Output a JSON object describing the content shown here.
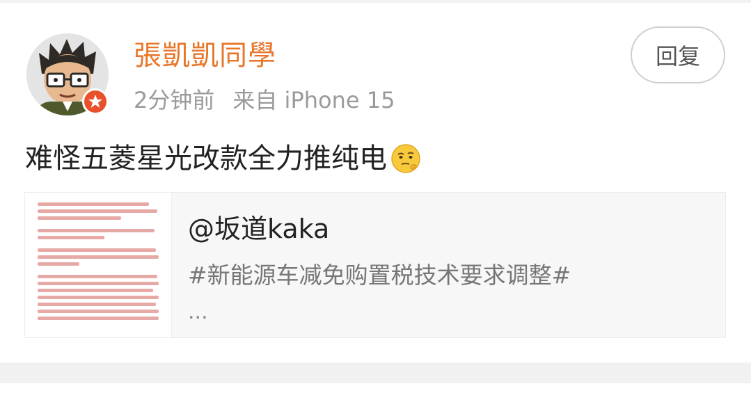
{
  "post": {
    "author": "張凱凱同學",
    "time": "2分钟前",
    "source": "来自 iPhone 15",
    "text": "难怪五菱星光改款全力推纯电",
    "emoji": "thinking-face-emoji",
    "reply_label": "回复"
  },
  "quote": {
    "author": "@坂道kaka",
    "topic": "#新能源车减免购置税技术要求调整#",
    "more": "..."
  },
  "colors": {
    "username": "#e8772b",
    "verified_badge": "#e8512b",
    "meta_text": "#9a9a9a",
    "body_text": "#222222",
    "quote_background": "#f7f7f7",
    "thumbnail_text": "#d9534f"
  }
}
